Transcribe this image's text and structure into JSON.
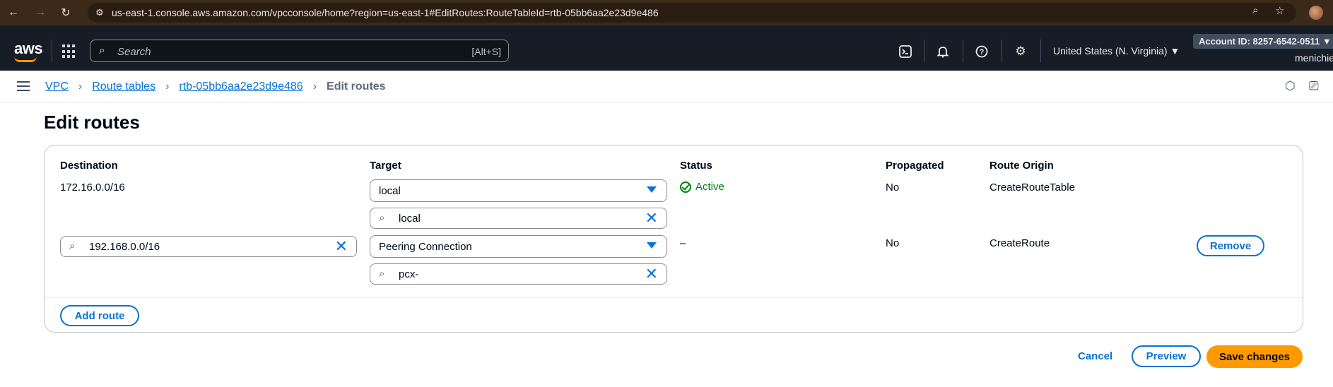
{
  "browser": {
    "url": "us-east-1.console.aws.amazon.com/vpcconsole/home?region=us-east-1#EditRoutes:RouteTableId=rtb-05bb6aa2e23d9e486"
  },
  "header": {
    "logo": "aws",
    "search_placeholder": "Search",
    "search_shortcut": "[Alt+S]",
    "region": "United States (N. Virginia) ▼",
    "account": "Account ID: 8257-6542-0511 ▼",
    "user": "menichie"
  },
  "breadcrumb": {
    "items": [
      "VPC",
      "Route tables",
      "rtb-05bb6aa2e23d9e486"
    ],
    "current": "Edit routes"
  },
  "page": {
    "title": "Edit routes"
  },
  "routes_table": {
    "columns": [
      "Destination",
      "Target",
      "Status",
      "Propagated",
      "Route Origin"
    ],
    "rows": [
      {
        "destination": "172.16.0.0/16",
        "target_type": "local",
        "target_value": "local",
        "status": "Active",
        "propagated": "No",
        "route_origin": "CreateRouteTable"
      },
      {
        "destination": "192.168.0.0/16",
        "target_type": "Peering Connection",
        "target_value": "pcx-",
        "status": "–",
        "propagated": "No",
        "route_origin": "CreateRoute",
        "remove_label": "Remove"
      }
    ],
    "add_route_label": "Add route"
  },
  "footer": {
    "cancel": "Cancel",
    "preview": "Preview",
    "save": "Save changes"
  },
  "colors": {
    "accent": "#0972d3",
    "primary_button": "#ff9900",
    "status_ok": "#037f0c",
    "header_bg": "#161d26"
  }
}
